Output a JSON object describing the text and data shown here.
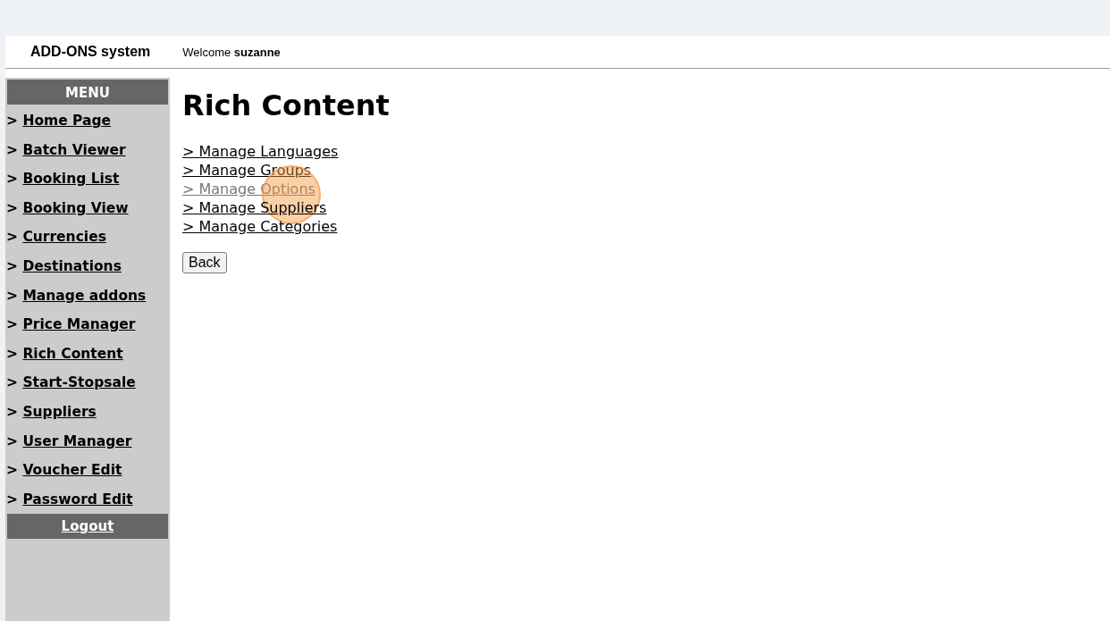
{
  "header": {
    "app_title": "ADD-ONS system",
    "welcome": "Welcome **suzanne**"
  },
  "sidebar": {
    "title": "MENU",
    "items": [
      {
        "marker": ">",
        "label": "Home Page"
      },
      {
        "marker": ">",
        "label": "Batch Viewer"
      },
      {
        "marker": ">",
        "label": "Booking List"
      },
      {
        "marker": ">",
        "label": "Booking View"
      },
      {
        "marker": ">",
        "label": "Currencies"
      },
      {
        "marker": ">",
        "label": "Destinations"
      },
      {
        "marker": ">",
        "label": "Manage addons"
      },
      {
        "marker": ">",
        "label": "Price Manager"
      },
      {
        "marker": ">",
        "label": "Rich Content"
      },
      {
        "marker": ">",
        "label": "Start-Stopsale"
      },
      {
        "marker": ">",
        "label": "Suppliers"
      },
      {
        "marker": ">",
        "label": "User Manager"
      },
      {
        "marker": ">",
        "label": "Voucher Edit"
      },
      {
        "marker": ">",
        "label": "Password Edit"
      }
    ],
    "logout": "Logout"
  },
  "main": {
    "title": "Rich Content",
    "links": [
      {
        "label": "> Manage Languages",
        "hovered": false
      },
      {
        "label": "> Manage Groups",
        "hovered": false
      },
      {
        "label": "> Manage Options",
        "hovered": true
      },
      {
        "label": "> Manage Suppliers",
        "hovered": false
      },
      {
        "label": "> Manage Categories",
        "hovered": false
      }
    ],
    "back_button": "Back"
  }
}
